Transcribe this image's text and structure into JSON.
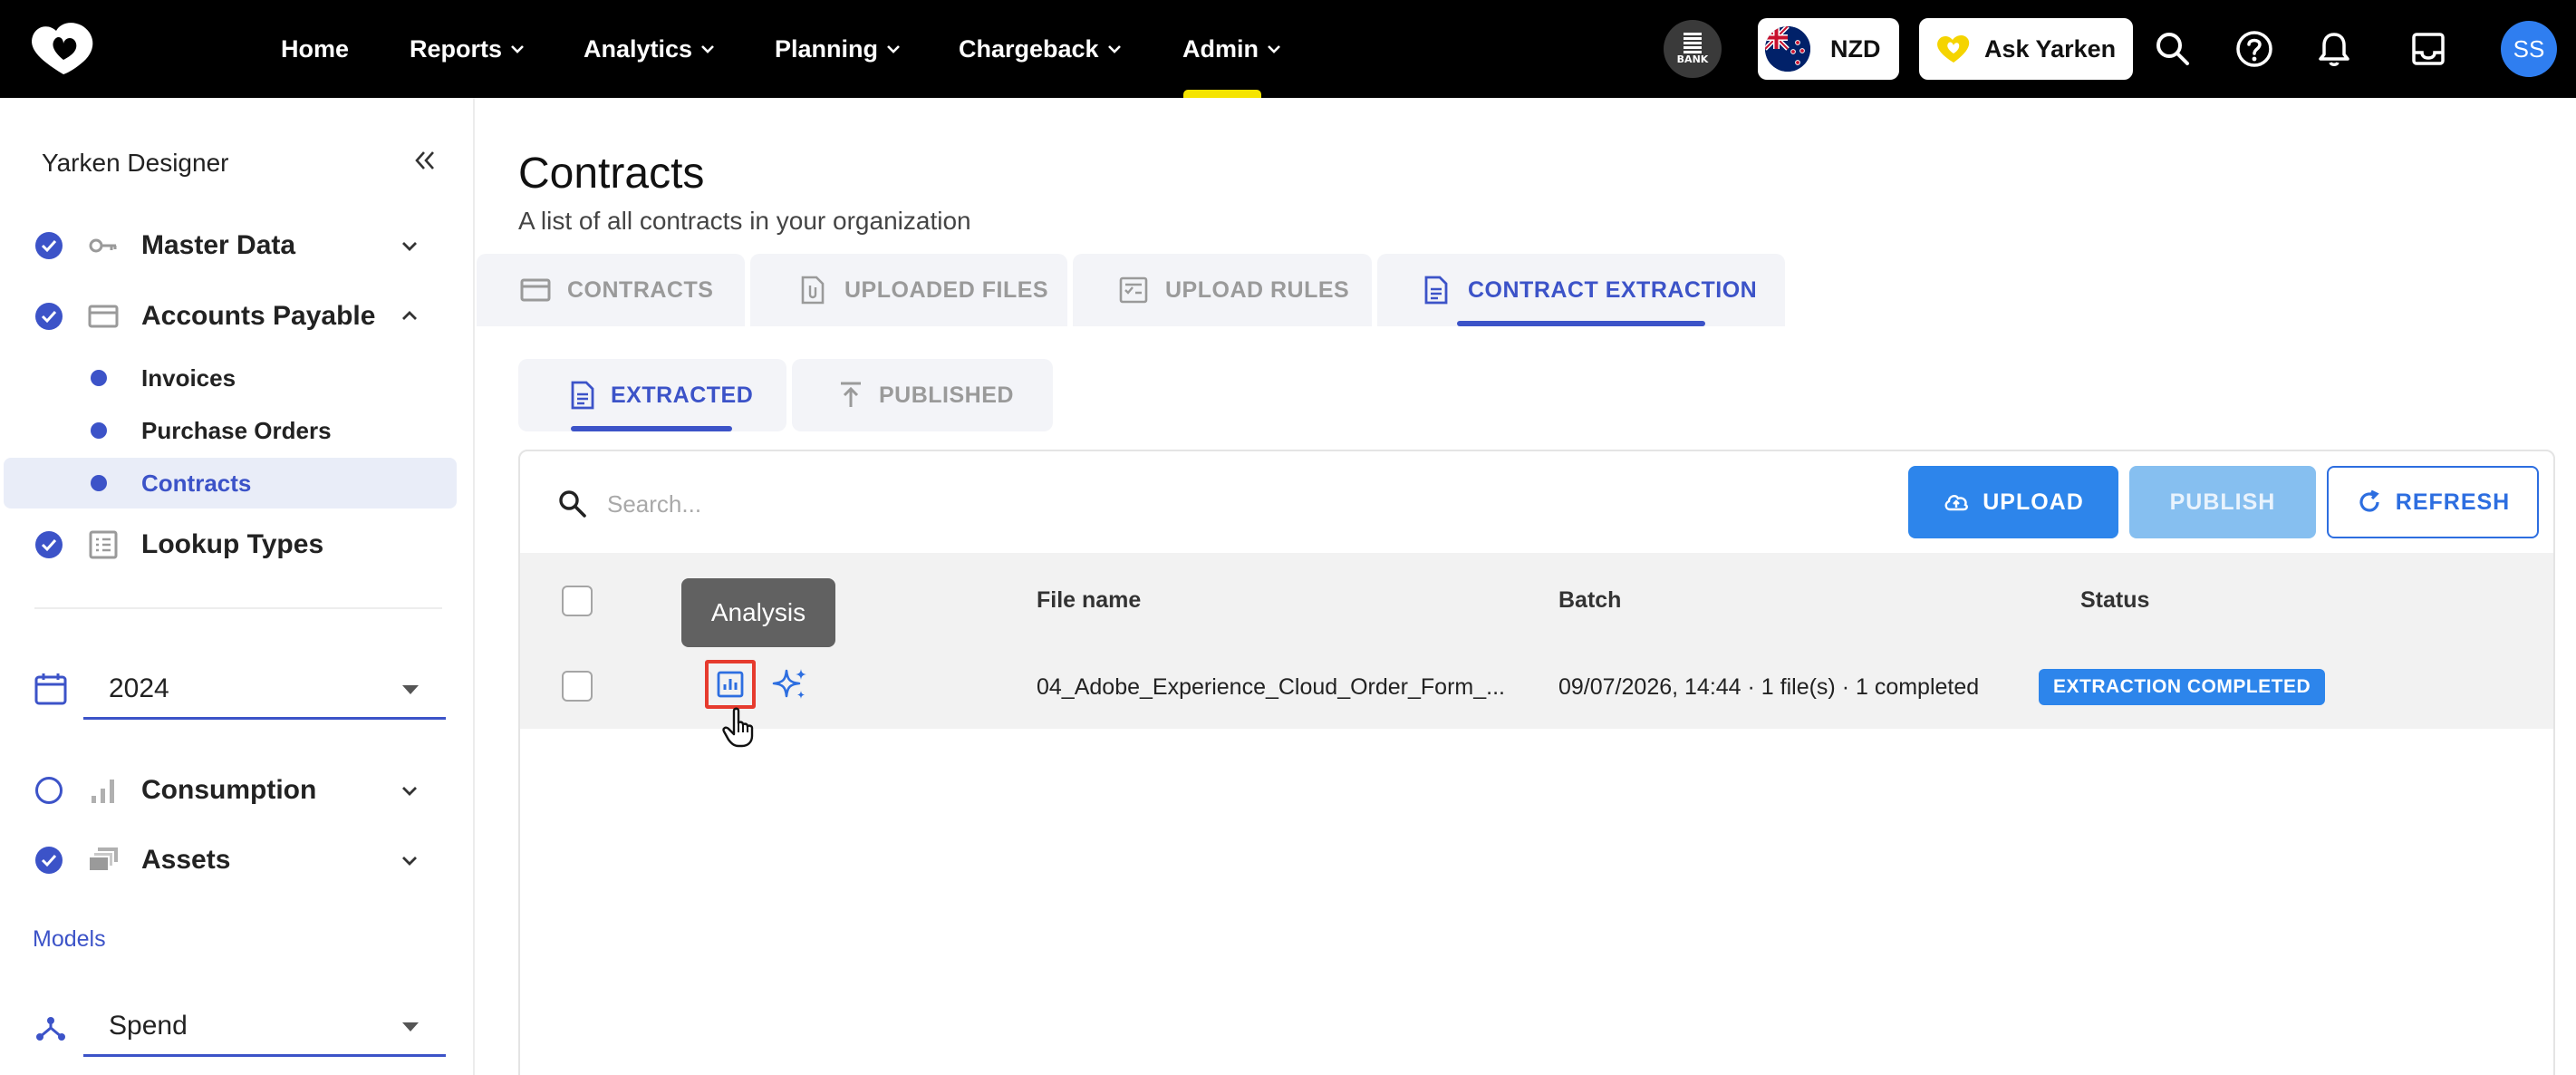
{
  "nav": {
    "items": [
      "Home",
      "Reports",
      "Analytics",
      "Planning",
      "Chargeback",
      "Admin"
    ],
    "bank_badge": "BANK",
    "currency": "NZD",
    "ask_label": "Ask Yarken",
    "avatar_initials": "SS"
  },
  "sidebar": {
    "title": "Yarken Designer",
    "master_data": "Master Data",
    "accounts_payable": "Accounts Payable",
    "sub_items": [
      "Invoices",
      "Purchase Orders",
      "Contracts"
    ],
    "lookup_types": "Lookup Types",
    "year": "2024",
    "consumption": "Consumption",
    "assets": "Assets",
    "models_label": "Models",
    "model_value": "Spend"
  },
  "page": {
    "title": "Contracts",
    "subtitle": "A list of all contracts in your organization"
  },
  "tabs": [
    "CONTRACTS",
    "UPLOADED FILES",
    "UPLOAD RULES",
    "CONTRACT EXTRACTION"
  ],
  "subtabs": [
    "EXTRACTED",
    "PUBLISHED"
  ],
  "toolbar": {
    "search_placeholder": "Search...",
    "upload": "UPLOAD",
    "publish": "PUBLISH",
    "refresh": "REFRESH"
  },
  "table": {
    "headers": {
      "file_name": "File name",
      "batch": "Batch",
      "status": "Status"
    },
    "rows": [
      {
        "file_name": "04_Adobe_Experience_Cloud_Order_Form_...",
        "batch": "09/07/2026, 14:44 · 1 file(s) · 1 completed",
        "status": "EXTRACTION COMPLETED"
      }
    ]
  },
  "tooltip": "Analysis",
  "colors": {
    "accent": "#3c53c8",
    "primary_button": "#2d85eb",
    "highlight": "#e63b2e",
    "admin_indicator": "#f5e400"
  }
}
